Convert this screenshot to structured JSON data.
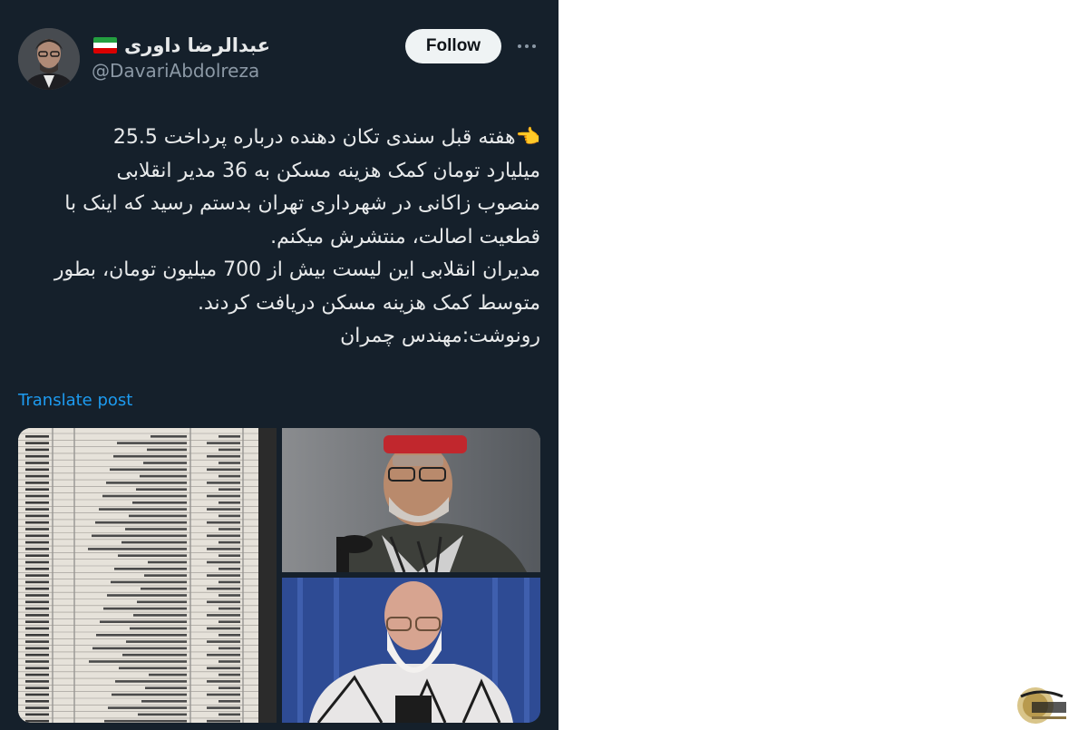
{
  "author": {
    "display_name": "عبدالرضا داوری",
    "handle": "@DavariAbdolreza",
    "flag_icon": "iran-flag-icon",
    "flag_colors": [
      "#239f40",
      "#ffffff",
      "#da0000"
    ]
  },
  "actions": {
    "follow_label": "Follow",
    "more_icon": "more-horizontal-icon"
  },
  "tweet": {
    "lines": [
      "👈هفته قبل سندی تکان دهنده درباره پرداخت 25.5",
      "میلیارد تومان کمک هزینه مسکن به 36 مدیر انقلابی",
      "منصوب زاکانی در شهرداری تهران بدستم رسید که اینک با",
      "قطعیت اصالت، منتشرش میکنم.",
      "مدیران انقلابی این لیست بیش از 700 میلیون تومان، بطور",
      "متوسط کمک هزینه مسکن دریافت کردند.",
      "رونوشت:مهندس چمران"
    ],
    "translate_label": "Translate post"
  },
  "colors": {
    "background": "#15202b",
    "text": "#e7e9ea",
    "secondary_text": "#8b98a5",
    "link": "#1d9bf0"
  }
}
